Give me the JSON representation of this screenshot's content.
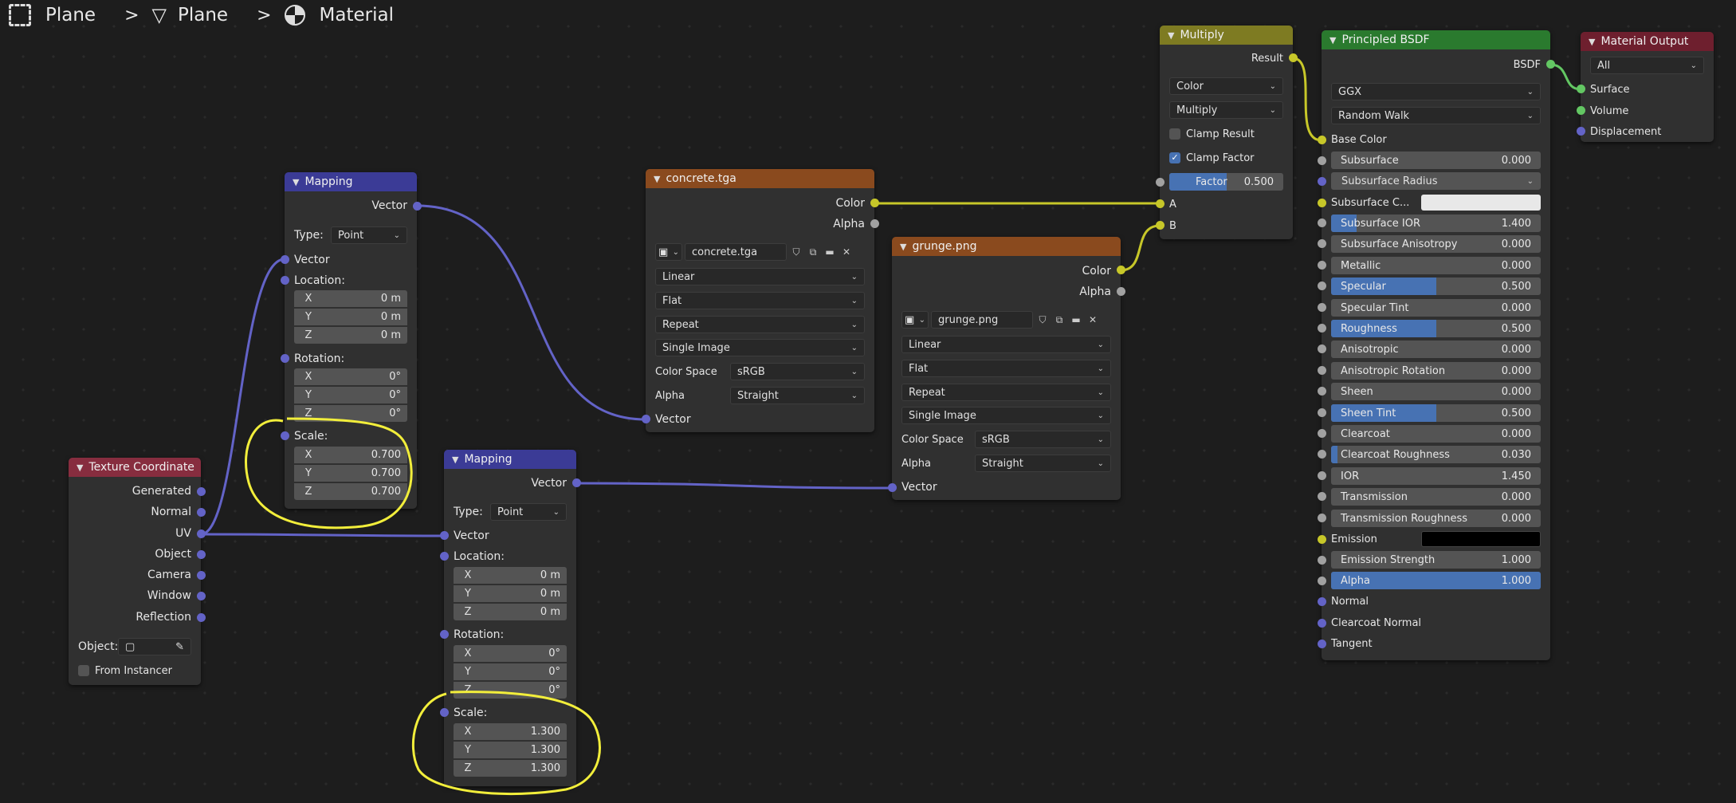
{
  "breadcrumb": {
    "item1": "Plane",
    "item2": "Plane",
    "item3": "Material"
  },
  "colors": {
    "mapping_header": "#3b3b96",
    "texcoord_header": "#872d3f",
    "texture_header": "#8a4a1e",
    "multiply_header": "#7e7b22",
    "bsdf_header": "#2a7a2e",
    "output_header": "#6e1f2e",
    "vector_socket": "#6363c7",
    "color_socket": "#c7c729",
    "float_socket": "#a1a1a1",
    "shader_socket": "#63c763",
    "highlight": "#f2ee3b"
  },
  "texcoord": {
    "title": "Texture Coordinate",
    "outputs": [
      "Generated",
      "Normal",
      "UV",
      "Object",
      "Camera",
      "Window",
      "Reflection"
    ],
    "object_label": "Object:",
    "from_instancer": "From Instancer"
  },
  "mapping1": {
    "title": "Mapping",
    "out_vector": "Vector",
    "type_label": "Type:",
    "type_value": "Point",
    "in_vector": "Vector",
    "location_label": "Location:",
    "loc": [
      "0 m",
      "0 m",
      "0 m"
    ],
    "rotation_label": "Rotation:",
    "rot": [
      "0°",
      "0°",
      "0°"
    ],
    "scale_label": "Scale:",
    "scale": [
      "0.700",
      "0.700",
      "0.700"
    ]
  },
  "mapping2": {
    "title": "Mapping",
    "out_vector": "Vector",
    "type_label": "Type:",
    "type_value": "Point",
    "in_vector": "Vector",
    "location_label": "Location:",
    "loc": [
      "0 m",
      "0 m",
      "0 m"
    ],
    "rotation_label": "Rotation:",
    "rot": [
      "0°",
      "0°",
      "0°"
    ],
    "scale_label": "Scale:",
    "scale": [
      "1.300",
      "1.300",
      "1.300"
    ]
  },
  "axes": [
    "X",
    "Y",
    "Z"
  ],
  "img1": {
    "title": "concrete.tga",
    "out_color": "Color",
    "out_alpha": "Alpha",
    "file": "concrete.tga",
    "interp": "Linear",
    "proj": "Flat",
    "ext": "Repeat",
    "source": "Single Image",
    "cs_label": "Color Space",
    "cs": "sRGB",
    "alpha_label": "Alpha",
    "alpha": "Straight",
    "in_vector": "Vector"
  },
  "img2": {
    "title": "grunge.png",
    "out_color": "Color",
    "out_alpha": "Alpha",
    "file": "grunge.png",
    "interp": "Linear",
    "proj": "Flat",
    "ext": "Repeat",
    "source": "Single Image",
    "cs_label": "Color Space",
    "cs": "sRGB",
    "alpha_label": "Alpha",
    "alpha": "Straight",
    "in_vector": "Vector"
  },
  "multiply": {
    "title": "Multiply",
    "result": "Result",
    "data_type": "Color",
    "blend": "Multiply",
    "clamp_result": "Clamp Result",
    "clamp_factor": "Clamp Factor",
    "factor_label": "Factor",
    "factor": "0.500",
    "factor_frac": 0.5,
    "in_a": "A",
    "in_b": "B"
  },
  "bsdf": {
    "title": "Principled BSDF",
    "out": "BSDF",
    "distribution": "GGX",
    "sss_method": "Random Walk",
    "base_color": "Base Color",
    "subsurface_label": "Subsurface",
    "subsurface": "0.000",
    "subsurface_radius": "Subsurface Radius",
    "subsurface_color": "Subsurface C...",
    "params": [
      {
        "label": "Subsurface IOR",
        "value": "1.400",
        "fill": 0.12
      },
      {
        "label": "Subsurface Anisotropy",
        "value": "0.000",
        "fill": 0
      },
      {
        "label": "Metallic",
        "value": "0.000",
        "fill": 0
      },
      {
        "label": "Specular",
        "value": "0.500",
        "fill": 0.5
      },
      {
        "label": "Specular Tint",
        "value": "0.000",
        "fill": 0
      },
      {
        "label": "Roughness",
        "value": "0.500",
        "fill": 0.5
      },
      {
        "label": "Anisotropic",
        "value": "0.000",
        "fill": 0
      },
      {
        "label": "Anisotropic Rotation",
        "value": "0.000",
        "fill": 0
      },
      {
        "label": "Sheen",
        "value": "0.000",
        "fill": 0
      },
      {
        "label": "Sheen Tint",
        "value": "0.500",
        "fill": 0.5
      },
      {
        "label": "Clearcoat",
        "value": "0.000",
        "fill": 0
      },
      {
        "label": "Clearcoat Roughness",
        "value": "0.030",
        "fill": 0.03
      },
      {
        "label": "IOR",
        "value": "1.450",
        "fill": 0
      },
      {
        "label": "Transmission",
        "value": "0.000",
        "fill": 0
      },
      {
        "label": "Transmission Roughness",
        "value": "0.000",
        "fill": 0
      }
    ],
    "emission": "Emission",
    "emission_strength_label": "Emission Strength",
    "emission_strength": "1.000",
    "alpha_label": "Alpha",
    "alpha": "1.000",
    "normal": "Normal",
    "clearcoat_normal": "Clearcoat Normal",
    "tangent": "Tangent"
  },
  "output": {
    "title": "Material Output",
    "target": "All",
    "surface": "Surface",
    "volume": "Volume",
    "displacement": "Displacement"
  }
}
